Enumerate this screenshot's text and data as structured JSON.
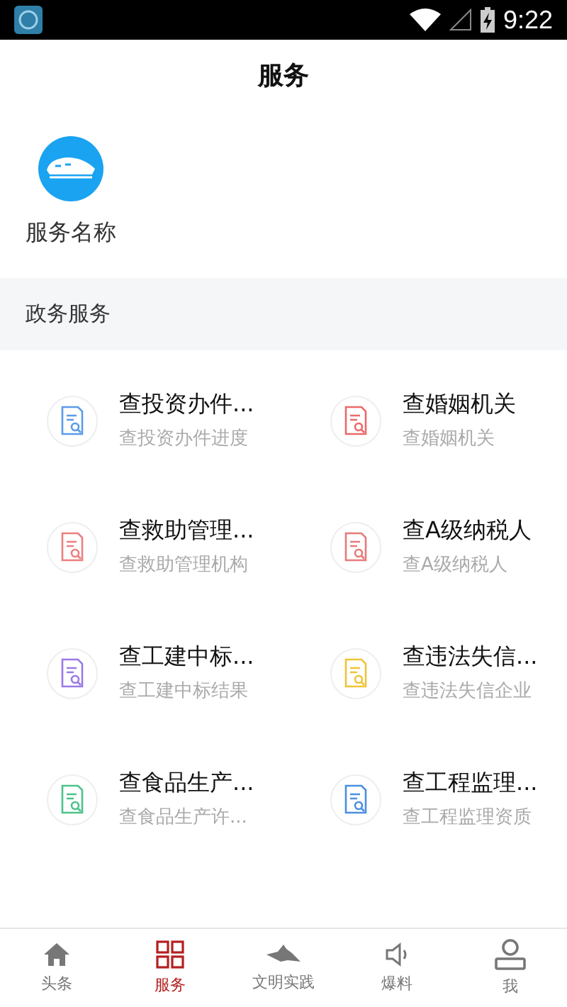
{
  "status_bar": {
    "time": "9:22"
  },
  "header": {
    "title": "服务"
  },
  "featured": [
    {
      "label": "服务名称"
    }
  ],
  "section": {
    "title": "政务服务"
  },
  "services": [
    {
      "title": "查投资办件...",
      "subtitle": "查投资办件进度",
      "color": "#5b9be6"
    },
    {
      "title": "查婚姻机关",
      "subtitle": "查婚姻机关",
      "color": "#ec6a6a"
    },
    {
      "title": "查救助管理...",
      "subtitle": "查救助管理机构",
      "color": "#ec7f7f"
    },
    {
      "title": "查A级纳税人",
      "subtitle": "查A级纳税人",
      "color": "#e87a7a"
    },
    {
      "title": "查工建中标...",
      "subtitle": "查工建中标结果",
      "color": "#9a7ae6"
    },
    {
      "title": "查违法失信...",
      "subtitle": "查违法失信企业",
      "color": "#efc43a"
    },
    {
      "title": "查食品生产...",
      "subtitle": "查食品生产许...",
      "color": "#4cc38a"
    },
    {
      "title": "查工程监理...",
      "subtitle": "查工程监理资质",
      "color": "#4a8fe0"
    }
  ],
  "tabs": [
    {
      "label": "头条",
      "kind": "home",
      "selected": false
    },
    {
      "label": "服务",
      "kind": "grid",
      "selected": true
    },
    {
      "label": "文明实践",
      "kind": "practice",
      "selected": false
    },
    {
      "label": "爆料",
      "kind": "speaker",
      "selected": false
    },
    {
      "label": "我",
      "kind": "user",
      "selected": false
    }
  ]
}
